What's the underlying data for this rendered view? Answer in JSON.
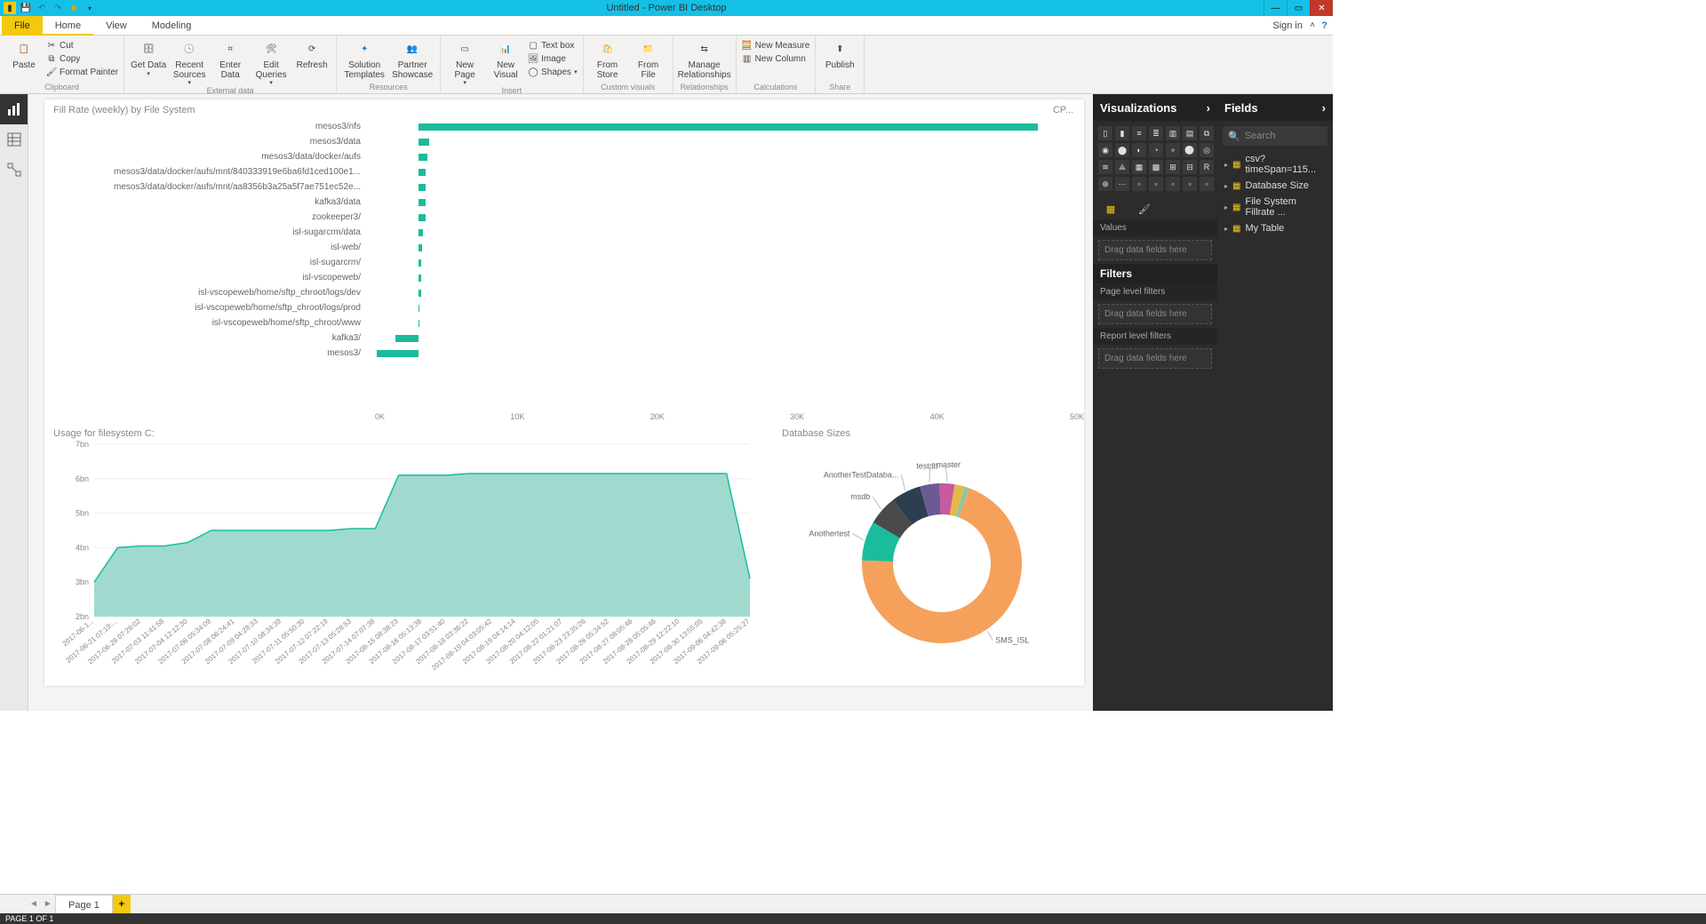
{
  "titlebar": {
    "title": "Untitled - Power BI Desktop"
  },
  "tabs": {
    "file": "File",
    "home": "Home",
    "view": "View",
    "modeling": "Modeling",
    "signin": "Sign in"
  },
  "ribbon": {
    "paste": "Paste",
    "cut": "Cut",
    "copy": "Copy",
    "format_painter": "Format Painter",
    "clipboard": "Clipboard",
    "get_data": "Get Data",
    "recent_sources": "Recent Sources",
    "enter_data": "Enter Data",
    "edit_queries": "Edit Queries",
    "refresh": "Refresh",
    "external_data": "External data",
    "solution_templates": "Solution Templates",
    "partner_showcase": "Partner Showcase",
    "resources": "Resources",
    "new_page": "New Page",
    "new_visual": "New Visual",
    "text_box": "Text box",
    "image": "Image",
    "shapes": "Shapes",
    "insert": "Insert",
    "from_store": "From Store",
    "from_file": "From File",
    "custom_visuals": "Custom visuals",
    "manage_relationships": "Manage Relationships",
    "relationships": "Relationships",
    "new_measure": "New Measure",
    "new_column": "New Column",
    "calculations": "Calculations",
    "publish": "Publish",
    "share": "Share"
  },
  "panes": {
    "visualizations": "Visualizations",
    "values": "Values",
    "values_placeholder": "Drag data fields here",
    "filters": "Filters",
    "page_filters": "Page level filters",
    "page_filters_ph": "Drag data fields here",
    "report_filters": "Report level filters",
    "report_filters_ph": "Drag data fields here",
    "fields": "Fields",
    "search": "Search",
    "field_items": [
      "csv?timeSpan=115...",
      "Database Size",
      "File System Fillrate ...",
      "My Table"
    ]
  },
  "chart1_title": "Fill Rate (weekly) by File System",
  "chart1_corner": "CP...",
  "chart2_title": "Usage for filesystem C:",
  "chart3_title": "Database Sizes",
  "page_tab": "Page 1",
  "status": "PAGE 1 OF 1",
  "chart_data": [
    {
      "type": "bar",
      "title": "Fill Rate (weekly) by File System",
      "xlim": [
        0,
        50000
      ],
      "xticks": [
        "0K",
        "10K",
        "20K",
        "30K",
        "40K",
        "50K"
      ],
      "categories": [
        "mesos3/nfs",
        "mesos3/data",
        "mesos3/data/docker/aufs",
        "mesos3/data/docker/aufs/mnt/840333919e6ba6fd1ced100e1...",
        "mesos3/data/docker/aufs/mnt/aa8356b3a25a5f7ae751ec52e...",
        "kafka3/data",
        "zookeeper3/",
        "isl-sugarcrm/data",
        "isl-web/",
        "isl-sugarcrm/",
        "isl-vscopeweb/",
        "isl-vscopeweb/home/sftp_chroot/logs/dev",
        "isl-vscopeweb/home/sftp_chroot/logs/prod",
        "isl-vscopeweb/home/sftp_chroot/www",
        "kafka3/",
        "mesos3/"
      ],
      "values": [
        47000,
        800,
        650,
        550,
        550,
        550,
        500,
        350,
        220,
        200,
        200,
        180,
        80,
        60,
        -1800,
        -3200
      ]
    },
    {
      "type": "area",
      "title": "Usage for filesystem C:",
      "ylim": [
        2000000000,
        7000000000
      ],
      "yticks": [
        "2bn",
        "3bn",
        "4bn",
        "5bn",
        "6bn",
        "7bn"
      ],
      "x": [
        "2017-06-1...",
        "2017-06-21 07:19:...",
        "2017-06-28 07:26:02",
        "2017-07-03 11:41:58",
        "2017-07-04 12:12:30",
        "2017-07-06 05:34:09",
        "2017-07-08 06:24:41",
        "2017-07-09 04:28:33",
        "2017-07-10 08:34:39",
        "2017-07-11 05:50:30",
        "2017-07-12 07:22:19",
        "2017-07-13 05:28:53",
        "2017-07-14 07:07:38",
        "2017-08-15 08:38:23",
        "2017-08-16 05:13:38",
        "2017-08-17 03:51:40",
        "2017-08-18 03:36:22",
        "2017-08-19 04:03:05:42",
        "2017-08-19 04:14:14",
        "2017-08-20 04:12:05",
        "2017-08-22 01:21:07",
        "2017-08-23 23:35:26",
        "2017-08-26 05:34:52",
        "2017-08-27 08:05:46",
        "2017-08-28 05:05:46",
        "2017-08-29 12:22:10",
        "2017-08-30 13:55:05",
        "2017-09-06 04:42:38",
        "2017-09-06 05:25:27"
      ],
      "values": [
        3000000000.0,
        4000000000.0,
        4050000000.0,
        4050000000.0,
        4150000000.0,
        4500000000.0,
        4500000000.0,
        4500000000.0,
        4500000000.0,
        4500000000.0,
        4500000000.0,
        4550000000.0,
        4550000000.0,
        6100000000.0,
        6100000000.0,
        6100000000.0,
        6150000000.0,
        6150000000.0,
        6150000000.0,
        6150000000.0,
        6150000000.0,
        6150000000.0,
        6150000000.0,
        6150000000.0,
        6150000000.0,
        6150000000.0,
        6150000000.0,
        6150000000.0,
        3100000000.0
      ]
    },
    {
      "type": "pie",
      "title": "Database Sizes",
      "series": [
        {
          "name": "SMS_ISL",
          "value": 70,
          "color": "#f5a15b"
        },
        {
          "name": "Anothertest",
          "value": 8,
          "color": "#1abc9c"
        },
        {
          "name": "msdb",
          "value": 6,
          "color": "#4a4a4a"
        },
        {
          "name": "AnotherTestDataba...",
          "value": 6,
          "color": "#2c3e50"
        },
        {
          "name": "testdb",
          "value": 4,
          "color": "#6b5b95"
        },
        {
          "name": "master",
          "value": 3,
          "color": "#c85a9e"
        },
        {
          "name": "",
          "value": 2,
          "color": "#e6b84a"
        },
        {
          "name": "",
          "value": 1,
          "color": "#8cc7a1"
        }
      ]
    }
  ]
}
